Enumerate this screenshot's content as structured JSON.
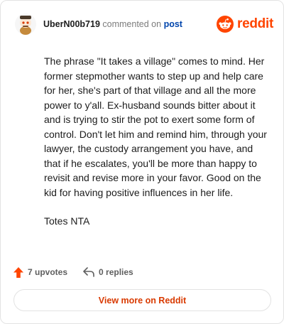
{
  "header": {
    "username": "UberN00b719",
    "action_text": "commented on",
    "post_link": "post",
    "brand_name": "reddit"
  },
  "comment": {
    "paragraphs": [
      "The phrase \"It takes a village\" comes to mind. Her former stepmother wants to step up and help care for her, she's part of that village and all the more power to y'all. Ex-husband sounds bitter about it and is trying to stir the pot to exert some form of control. Don't let him and remind him, through your lawyer, the custody arrangement you have, and that if he escalates, you'll be more than happy to revisit and revise more in your favor. Good on the kid for having positive influences in her life.",
      "Totes NTA"
    ]
  },
  "footer": {
    "upvotes_label": "7 upvotes",
    "replies_label": "0 replies"
  },
  "cta": {
    "label": "View more on Reddit"
  },
  "colors": {
    "brand": "#ff4500",
    "link": "#0045ac",
    "cta_text": "#d93a00"
  },
  "icons": [
    "avatar",
    "reddit-logo-icon",
    "upvote-arrow-icon",
    "reply-arrow-icon"
  ]
}
